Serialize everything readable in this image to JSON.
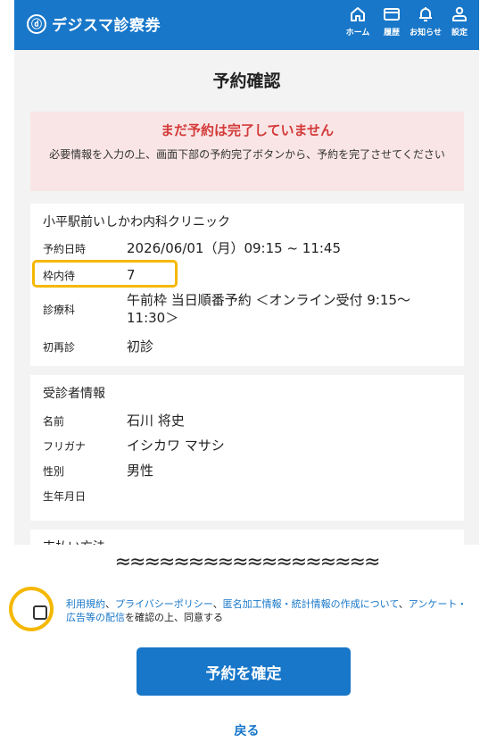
{
  "header": {
    "brand": "デジスマ診察券",
    "logo_mark": "ⓓ",
    "nav": [
      {
        "label": "ホーム",
        "icon": "home-icon"
      },
      {
        "label": "履歴",
        "icon": "history-icon"
      },
      {
        "label": "お知らせ",
        "icon": "bell-icon"
      },
      {
        "label": "設定",
        "icon": "user-settings-icon"
      }
    ]
  },
  "page_title": "予約確認",
  "alert": {
    "title": "まだ予約は完了していません",
    "message": "必要情報を入力の上、画面下部の予約完了ボタンから、予約を完了させてください"
  },
  "reservation": {
    "clinic": "小平駅前いしかわ内科クリニック",
    "rows": [
      {
        "key": "予約日時",
        "value": "2026/06/01（月）09:15 ~ 11:45"
      },
      {
        "key": "枠内待",
        "value": "7"
      },
      {
        "key": "診療科",
        "value": "午前枠 当日順番予約 ＜オンライン受付 9:15〜11:30＞"
      },
      {
        "key": "初再診",
        "value": "初診"
      }
    ]
  },
  "patient": {
    "title": "受診者情報",
    "rows": [
      {
        "key": "名前",
        "value": "石川 将史"
      },
      {
        "key": "フリガナ",
        "value": "イシカワ マサシ"
      },
      {
        "key": "性別",
        "value": "男性"
      },
      {
        "key": "生年月日",
        "value": ""
      }
    ]
  },
  "payment": {
    "title": "支払い方法"
  },
  "wave_text": "≈≈≈≈≈≈≈≈≈≈≈≈≈≈≈≈≈≈",
  "agreement": {
    "link1": "利用規約",
    "sep1": "、",
    "link2": "プライバシーポリシー",
    "sep2": "、",
    "link3": "匿名加工情報・統計情報の作成について",
    "sep3": "、",
    "link4": "アンケート・広告等の配信",
    "suffix": "を確認の上、同意する",
    "checked": false
  },
  "buttons": {
    "confirm": "予約を確定",
    "back": "戻る"
  },
  "colors": {
    "brand": "#1877c9",
    "alert_bg": "#f9e5e5",
    "alert_text": "#d33a3a",
    "highlight": "#f5b800"
  }
}
